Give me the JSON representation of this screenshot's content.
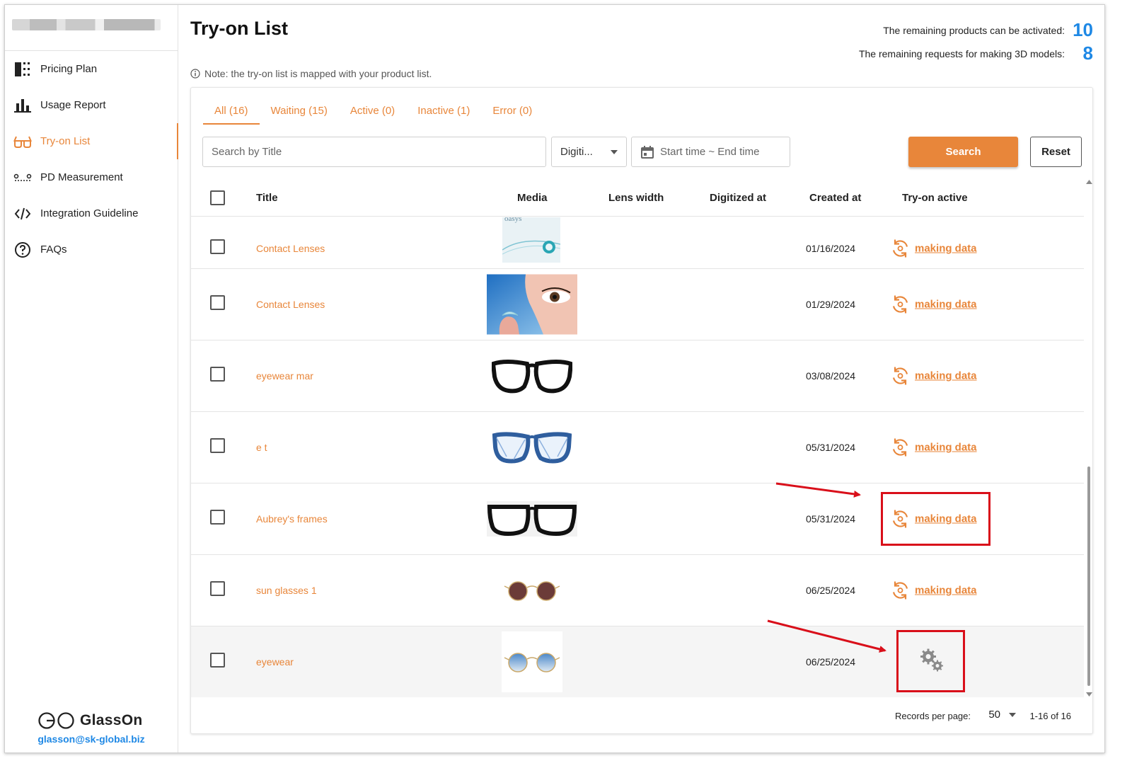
{
  "sidebar": {
    "items": [
      {
        "label": "Pricing Plan",
        "icon": "pricing-icon"
      },
      {
        "label": "Usage Report",
        "icon": "bar-chart-icon"
      },
      {
        "label": "Try-on List",
        "icon": "glasses-icon",
        "active": true
      },
      {
        "label": "PD Measurement",
        "icon": "pd-measure-icon"
      },
      {
        "label": "Integration Guideline",
        "icon": "code-icon"
      },
      {
        "label": "FAQs",
        "icon": "question-icon"
      }
    ],
    "logo_text": "GlassOn",
    "email": "glasson@sk-global.biz"
  },
  "header": {
    "title": "Try-on List",
    "remaining_products_label": "The remaining products can be activated:",
    "remaining_products_value": "10",
    "remaining_requests_label": "The remaining requests for making 3D models:",
    "remaining_requests_value": "8",
    "note": "Note: the try-on list is mapped with your product list."
  },
  "tabs": [
    {
      "label": "All (16)",
      "active": true
    },
    {
      "label": "Waiting (15)"
    },
    {
      "label": "Active (0)"
    },
    {
      "label": "Inactive (1)"
    },
    {
      "label": "Error (0)"
    }
  ],
  "filters": {
    "search_placeholder": "Search by Title",
    "select_value": "Digiti...",
    "date_placeholder": "Start time ~ End time",
    "search_button": "Search",
    "reset_button": "Reset"
  },
  "table": {
    "columns": [
      "Title",
      "Media",
      "Lens width",
      "Digitized at",
      "Created at",
      "Try-on active"
    ],
    "rows": [
      {
        "title": "Contact Lenses",
        "media": "contact-lens-box-image",
        "created_at": "01/16/2024",
        "status": "making data"
      },
      {
        "title": "Contact Lenses",
        "media": "contact-lens-eye-image",
        "created_at": "01/29/2024",
        "status": "making data"
      },
      {
        "title": "eyewear mar",
        "media": "black-cateye-glasses-image",
        "created_at": "03/08/2024",
        "status": "making data"
      },
      {
        "title": "e t",
        "media": "blue-frame-glasses-image",
        "created_at": "05/31/2024",
        "status": "making data"
      },
      {
        "title": "Aubrey's frames",
        "media": "black-square-glasses-image",
        "created_at": "05/31/2024",
        "status": "making data"
      },
      {
        "title": "sun glasses 1",
        "media": "round-sunglasses-image",
        "created_at": "06/25/2024",
        "status": "making data"
      },
      {
        "title": "eyewear",
        "media": "blue-tint-round-glasses-image",
        "created_at": "06/25/2024",
        "status": "processing"
      }
    ]
  },
  "pagination": {
    "records_label": "Records per page:",
    "records_value": "50",
    "range": "1-16 of 16"
  },
  "colors": {
    "accent": "#e8863a",
    "blue": "#1e88e5",
    "annotation_red": "#d90f1a"
  }
}
